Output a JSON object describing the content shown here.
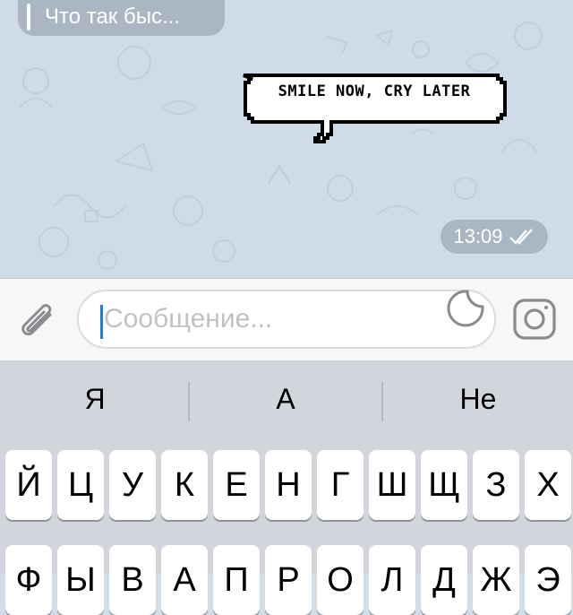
{
  "reply": {
    "text": "Что так быс..."
  },
  "message": {
    "sticker_text": "SMILE NOW, CRY LATER",
    "time": "13:09"
  },
  "input": {
    "placeholder": "Сообщение..."
  },
  "icons": {
    "attach": "paperclip-icon",
    "sticker": "sticker-icon",
    "camera": "camera-icon",
    "read": "double-check-icon"
  },
  "keyboard": {
    "suggestions": [
      "Я",
      "А",
      "Не"
    ],
    "row1": [
      "Й",
      "Ц",
      "У",
      "К",
      "Е",
      "Н",
      "Г",
      "Ш",
      "Щ",
      "З",
      "Х"
    ],
    "row2": [
      "Ф",
      "Ы",
      "В",
      "А",
      "П",
      "Р",
      "О",
      "Л",
      "Д",
      "Ж",
      "Э"
    ]
  },
  "colors": {
    "caret": "#1e7be0",
    "chat_bg": "#cfdce8",
    "badge": "#a9b7c4"
  }
}
